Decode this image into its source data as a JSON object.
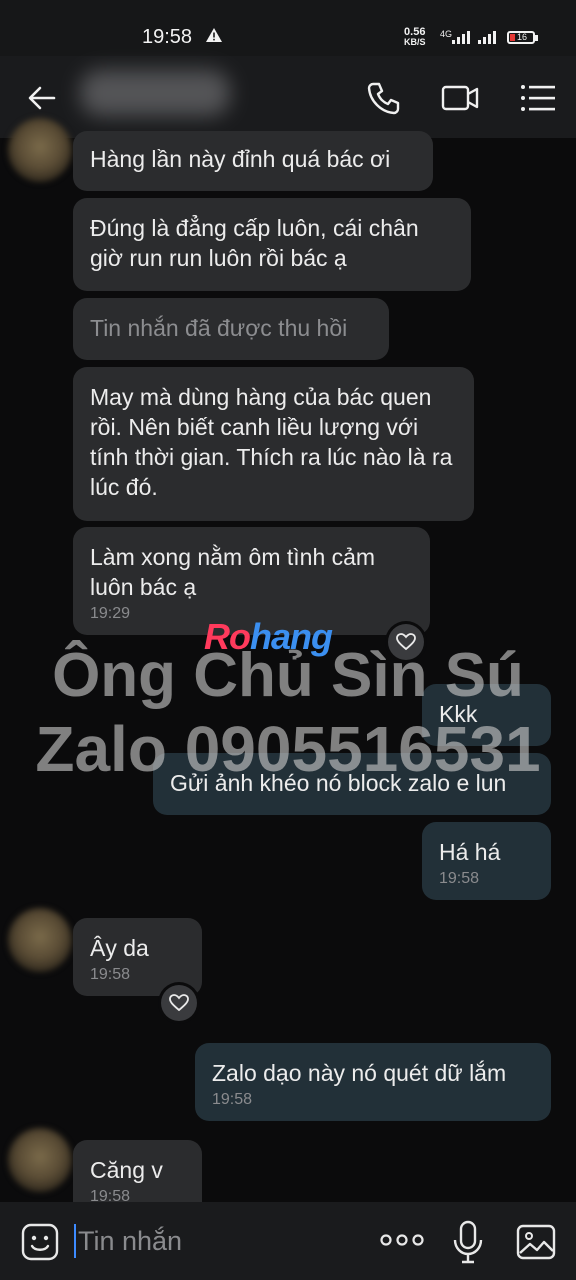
{
  "status_bar": {
    "time": "19:58",
    "net_speed_value": "0.56",
    "net_speed_unit": "KB/S",
    "network": "4G",
    "battery": "16",
    "icons": [
      "warning-icon",
      "signal-icon",
      "battery-icon"
    ]
  },
  "header": {
    "icons": [
      "back-arrow-icon",
      "phone-icon",
      "video-call-icon",
      "menu-list-icon"
    ]
  },
  "messages": [
    {
      "dir": "in",
      "text": "Hàng lần này đỉnh quá bác ơi",
      "time": ""
    },
    {
      "dir": "in",
      "text": "Đúng là đẳng cấp luôn, cái chân giờ run run luôn rồi bác ạ",
      "time": ""
    },
    {
      "dir": "in",
      "text": "Tin nhắn đã được thu hồi",
      "time": "",
      "recalled": true
    },
    {
      "dir": "in",
      "text": "May mà dùng hàng của bác quen rồi. Nên biết canh liều lượng với tính thời gian. Thích ra lúc nào là ra lúc đó.",
      "time": ""
    },
    {
      "dir": "in",
      "text": "Làm xong nằm ôm tình cảm luôn bác ạ",
      "time": "19:29"
    },
    {
      "dir": "out",
      "text": "Kkk",
      "time": ""
    },
    {
      "dir": "out",
      "text": "Gửi ảnh khéo nó block zalo e lun",
      "time": ""
    },
    {
      "dir": "out",
      "text": "Há há",
      "time": "19:58"
    },
    {
      "dir": "in",
      "text": "Ây da",
      "time": "19:58"
    },
    {
      "dir": "out",
      "text": "Zalo dạo này nó quét dữ lắm",
      "time": "19:58"
    },
    {
      "dir": "in",
      "text": "Căng v",
      "time": "19:58"
    }
  ],
  "watermark": {
    "logo_part1": "Ro",
    "logo_part2": "hang",
    "line1": "Ông Chủ Sìn Sú",
    "line2": "Zalo 0905516531"
  },
  "input_bar": {
    "placeholder": "Tin nhắn",
    "icons": [
      "emoji-icon",
      "more-dots-icon",
      "microphone-icon",
      "image-icon"
    ]
  },
  "colors": {
    "background": "#0b0b0c",
    "incoming_bubble": "#2b2c2e",
    "outgoing_bubble": "#223038",
    "caret": "#3d8bff"
  }
}
